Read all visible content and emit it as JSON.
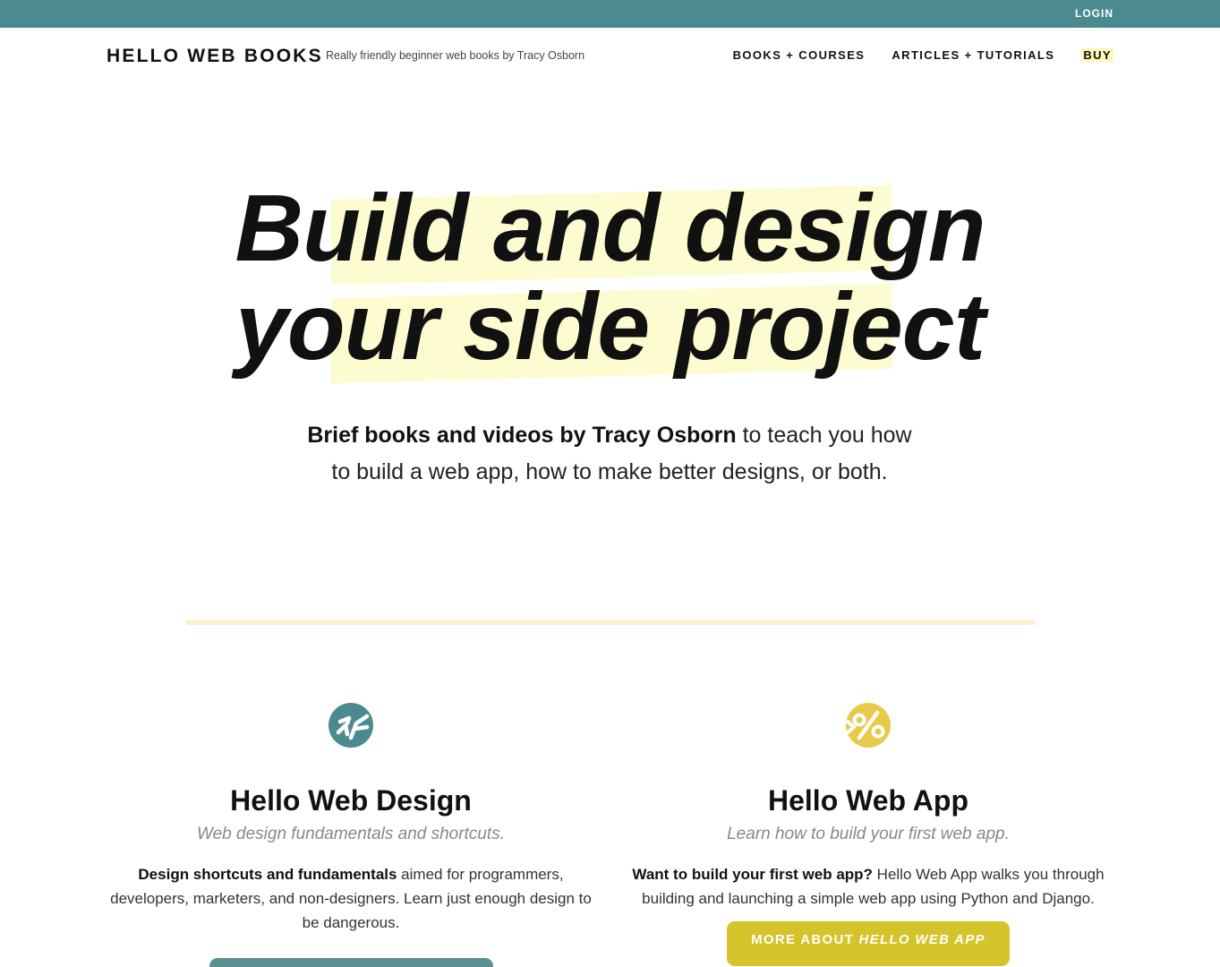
{
  "topbar": {
    "login_label": "LOGIN"
  },
  "header": {
    "logo": "HELLO WEB BOOKS",
    "tagline": "Really friendly beginner web books by Tracy Osborn",
    "nav": [
      {
        "label": "BOOKS + COURSES"
      },
      {
        "label": "ARTICLES + TUTORIALS"
      },
      {
        "label": "BUY"
      }
    ]
  },
  "hero": {
    "headline_line1": "Build and design",
    "headline_line2": "your side project",
    "subhead_bold": "Brief books and videos by Tracy Osborn",
    "subhead_rest": " to teach you how to build a web app, how to make better designs, or both."
  },
  "products": [
    {
      "icon": "hello-web-design-logo-icon",
      "title": "Hello Web Design",
      "subtitle": "Web design fundamentals and shortcuts.",
      "desc_bold": "Design shortcuts and fundamentals",
      "desc_rest": " aimed for programmers, developers, marketers, and non-designers. Learn just enough design to be dangerous.",
      "button_label": ""
    },
    {
      "icon": "hello-web-app-logo-icon",
      "title": "Hello Web App",
      "subtitle": "Learn how to build your first web app.",
      "desc_bold": "Want to build your first web app?",
      "desc_rest": " Hello Web App walks you through building and launching a simple web app using Python and Django.",
      "button_prefix": "MORE ABOUT ",
      "button_emph": "HELLO WEB APP"
    }
  ],
  "colors": {
    "topbar": "#4b8b8f",
    "highlight": "#fdfcd0",
    "divider": "#fdf0d2",
    "teal_icon": "#4b8b8f",
    "yellow_icon": "#e8c94a",
    "yellow_button": "#d4c32a"
  }
}
